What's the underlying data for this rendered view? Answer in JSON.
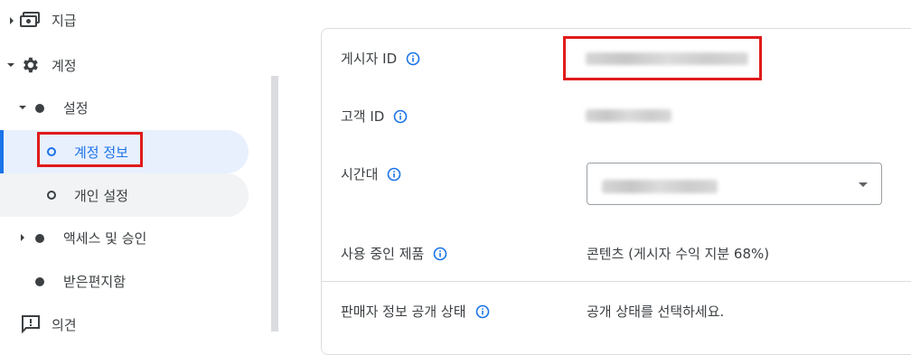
{
  "sidebar": {
    "items": [
      {
        "label": "지급",
        "icon": "payments-icon"
      },
      {
        "label": "계정",
        "icon": "gear-icon"
      },
      {
        "label": "설정"
      },
      {
        "label": "계정 정보",
        "selected": true
      },
      {
        "label": "개인 설정"
      },
      {
        "label": "액세스 및 승인"
      },
      {
        "label": "받은편지함"
      },
      {
        "label": "의견",
        "icon": "feedback-icon"
      }
    ]
  },
  "main": {
    "fields": [
      {
        "label": "게시자 ID",
        "value_redacted": true
      },
      {
        "label": "고객 ID",
        "value_redacted": true
      },
      {
        "label": "시간대",
        "value_redacted": true,
        "control": "dropdown"
      },
      {
        "label": "사용 중인 제품",
        "value": "콘텐츠 (게시자 수익 지분 68%)"
      },
      {
        "label": "판매자 정보 공개 상태",
        "value": "공개 상태를 선택하세요."
      }
    ]
  },
  "colors": {
    "accent": "#1a73e8",
    "selected_bg": "#e8f0fe",
    "hover_bg": "#f1f3f4",
    "highlight_box": "#e01b1b",
    "text": "#3c4043"
  }
}
